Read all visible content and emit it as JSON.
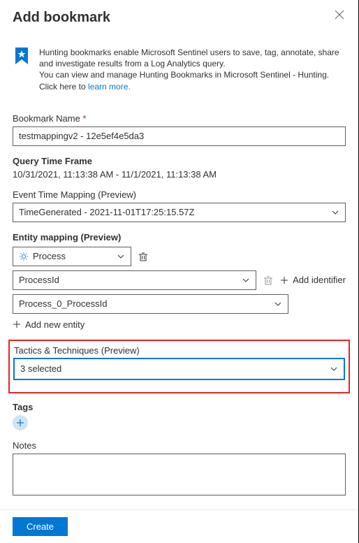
{
  "header": {
    "title": "Add bookmark"
  },
  "intro": {
    "line1": "Hunting bookmarks enable Microsoft Sentinel users to save, tag, annotate, share and investigate results from a Log Analytics query.",
    "line2": "You can view and manage Hunting Bookmarks in Microsoft Sentinel - Hunting.",
    "clickHere": "Click here to ",
    "learnMore": "learn more."
  },
  "bookmarkName": {
    "label": "Bookmark Name",
    "value": "testmappingv2 - 12e5ef4e5da3"
  },
  "queryTimeFrame": {
    "label": "Query Time Frame",
    "value": "10/31/2021, 11:13:38 AM - 11/1/2021, 11:13:38 AM"
  },
  "eventTimeMapping": {
    "label": "Event Time Mapping (Preview)",
    "value": "TimeGenerated - 2021-11-01T17:25:15.57Z"
  },
  "entityMapping": {
    "label": "Entity mapping (Preview)",
    "entityType": "Process",
    "identifier": "ProcessId",
    "valueField": "Process_0_ProcessId",
    "addIdentifier": "Add identifier",
    "addNewEntity": "Add new entity"
  },
  "tactics": {
    "label": "Tactics & Techniques (Preview)",
    "value": "3 selected"
  },
  "tags": {
    "label": "Tags"
  },
  "notes": {
    "label": "Notes"
  },
  "footer": {
    "create": "Create"
  }
}
